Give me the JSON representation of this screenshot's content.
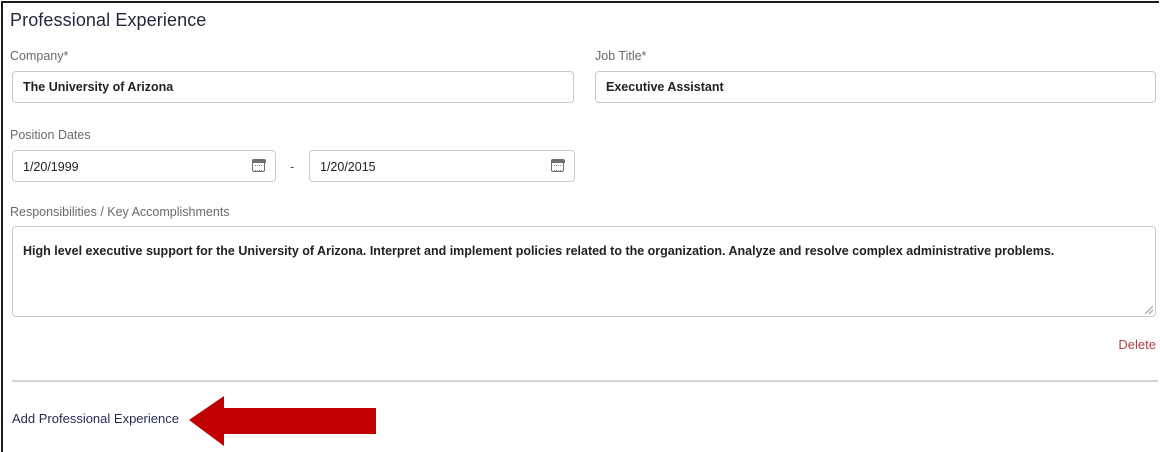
{
  "section": {
    "title": "Professional Experience"
  },
  "company": {
    "label": "Company*",
    "value": "The University of Arizona"
  },
  "job_title": {
    "label": "Job Title*",
    "value": "Executive Assistant"
  },
  "position_dates": {
    "label": "Position Dates",
    "start": "1/20/1999",
    "separator": "-",
    "end": "1/20/2015",
    "icon": "calendar-icon"
  },
  "responsibilities": {
    "label": "Responsibilities / Key Accomplishments",
    "value": "High level executive support for the University of Arizona. Interpret and implement policies related to the organization. Analyze and resolve complex administrative problems."
  },
  "actions": {
    "delete_label": "Delete",
    "add_label": "Add Professional Experience"
  },
  "colors": {
    "delete": "#b0413e",
    "add_link": "#1f2d4e",
    "annotation_arrow": "#c00000"
  }
}
